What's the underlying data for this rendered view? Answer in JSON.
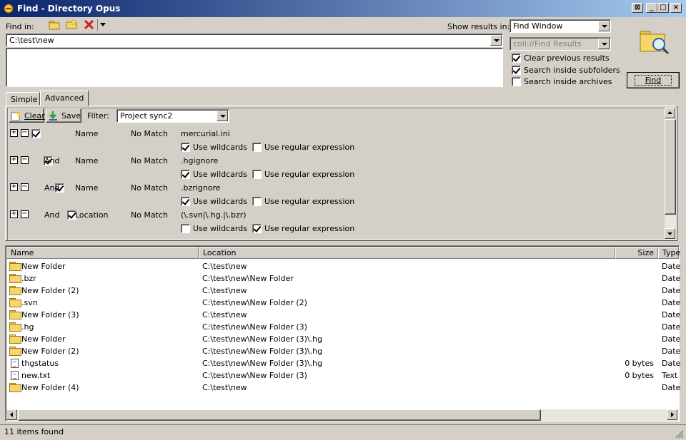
{
  "window": {
    "title": "Find - Directory Opus"
  },
  "top": {
    "find_in_label": "Find in:",
    "find_in_path": "C:\\test\\new",
    "show_results_label": "Show results in:",
    "show_results_value": "Find Window",
    "collection_value": "coll://Find Results",
    "clear_previous": "Clear previous results",
    "search_subfolders": "Search inside subfolders",
    "search_archives": "Search inside archives",
    "find_button": "Find"
  },
  "tabs": [
    "Simple",
    "Advanced"
  ],
  "toolbar": {
    "clear": "Clear",
    "save": "Save",
    "filter_label": "Filter:",
    "filter_value": "Project sync2"
  },
  "clauses": [
    {
      "join": "",
      "field": "Name",
      "match": "No Match",
      "value": "mercurial.ini",
      "wildcards": true,
      "regex": false
    },
    {
      "join": "And",
      "field": "Name",
      "match": "No Match",
      "value": ".hgignore",
      "wildcards": true,
      "regex": false
    },
    {
      "join": "And",
      "field": "Name",
      "match": "No Match",
      "value": ".bzrignore",
      "wildcards": true,
      "regex": false
    },
    {
      "join": "And",
      "field": "Location",
      "match": "No Match",
      "value": "(\\.svn|\\.hg.|\\.bzr)",
      "wildcards": false,
      "regex": true
    }
  ],
  "clause_labels": {
    "use_wildcards": "Use wildcards",
    "use_regex": "Use regular expression"
  },
  "columns": {
    "name": "Name",
    "location": "Location",
    "size": "Size",
    "type": "Type"
  },
  "results": [
    {
      "icon": "folder-icon",
      "name": "New Folder",
      "location": "C:\\test\\new",
      "size": "",
      "type": "Date"
    },
    {
      "icon": "folder-icon",
      "name": ".bzr",
      "location": "C:\\test\\new\\New Folder",
      "size": "",
      "type": "Date"
    },
    {
      "icon": "folder-icon",
      "name": "New Folder (2)",
      "location": "C:\\test\\new",
      "size": "",
      "type": "Date"
    },
    {
      "icon": "folder-icon",
      "name": ".svn",
      "location": "C:\\test\\new\\New Folder (2)",
      "size": "",
      "type": "Date"
    },
    {
      "icon": "folder-icon",
      "name": "New Folder (3)",
      "location": "C:\\test\\new",
      "size": "",
      "type": "Date"
    },
    {
      "icon": "folder-icon",
      "name": ".hg",
      "location": "C:\\test\\new\\New Folder (3)",
      "size": "",
      "type": "Date"
    },
    {
      "icon": "folder-icon",
      "name": "New Folder",
      "location": "C:\\test\\new\\New Folder (3)\\.hg",
      "size": "",
      "type": "Date"
    },
    {
      "icon": "folder-icon",
      "name": "New Folder (2)",
      "location": "C:\\test\\new\\New Folder (3)\\.hg",
      "size": "",
      "type": "Date"
    },
    {
      "icon": "file-icon",
      "name": "thgstatus",
      "location": "C:\\test\\new\\New Folder (3)\\.hg",
      "size": "0 bytes",
      "type": "Date"
    },
    {
      "icon": "text-file-icon",
      "name": "new.txt",
      "location": "C:\\test\\new\\New Folder (3)",
      "size": "0 bytes",
      "type": "Text"
    },
    {
      "icon": "folder-icon",
      "name": "New Folder (4)",
      "location": "C:\\test\\new",
      "size": "",
      "type": "Date"
    }
  ],
  "status": "11 items found"
}
